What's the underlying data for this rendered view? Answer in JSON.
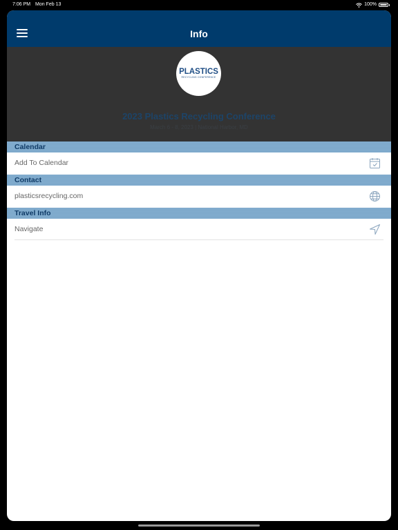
{
  "status_bar": {
    "time": "7:06 PM",
    "date": "Mon Feb 13",
    "battery_pct": "100%"
  },
  "navbar": {
    "title": "Info",
    "menu_icon": "hamburger-menu-icon"
  },
  "hero": {
    "logo_main": "PLASTICS",
    "logo_sub": "RECYCLING CONFERENCE",
    "event_title": "2023 Plastics Recycling Conference",
    "event_subtitle": "March 6 - 8, 2023 | National Harbor, MD"
  },
  "sections": [
    {
      "header": "Calendar",
      "row_label": "Add To Calendar",
      "row_icon": "calendar-check-icon"
    },
    {
      "header": "Contact",
      "row_label": "plasticsrecycling.com",
      "row_icon": "globe-icon"
    },
    {
      "header": "Travel Info",
      "row_label": "Navigate",
      "row_icon": "navigation-arrow-icon"
    }
  ],
  "colors": {
    "navbar": "#003b6c",
    "hero": "#333333",
    "section_header": "#85afd0",
    "section_text": "#0f3a66"
  }
}
